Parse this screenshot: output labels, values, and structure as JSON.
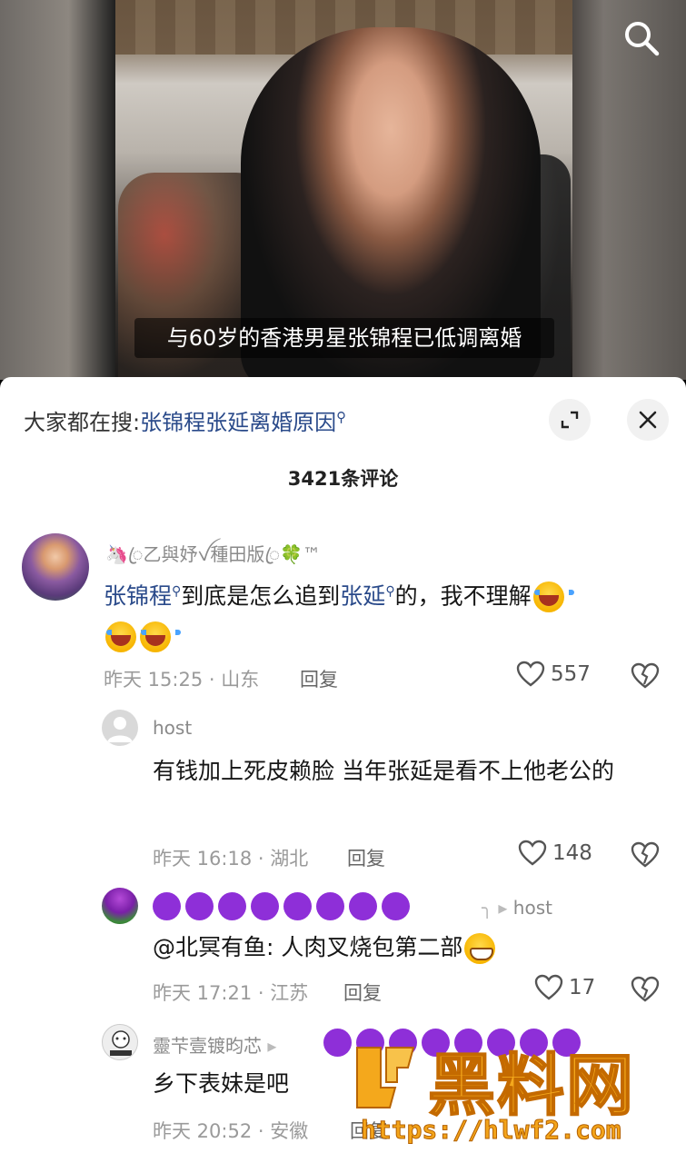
{
  "video": {
    "subtitle": "与60岁的香港男星张锦程已低调离婚"
  },
  "search_hint": {
    "prefix": "大家都在搜:",
    "keyword": "张锦程张延离婚原因"
  },
  "comment_count": "3421条评论",
  "comments": [
    {
      "username": "🦄ꦿ乙與妤ꪜ種田版ꦿ🍀™",
      "text_parts": {
        "link1": "张锦程",
        "mid1": "到底是怎么追到",
        "link2": "张延",
        "mid2": "的，我不理解"
      },
      "meta": "昨天 15:25 · 山东",
      "reply": "回复",
      "likes": "557"
    },
    {
      "username": "host",
      "text": "有钱加上死皮赖脸 当年张延是看不上他老公的",
      "meta": "昨天 16:18 · 湖北",
      "reply": "回复",
      "likes": "148"
    },
    {
      "reply_to": "host",
      "text": "@北冥有鱼: 人肉叉烧包第二部",
      "meta": "昨天 17:21 · 江苏",
      "reply": "回复",
      "likes": "17"
    },
    {
      "username": "靈芐壹镀昀芯",
      "text": "乡下表妹是吧",
      "meta": "昨天 20:52 · 安徽",
      "reply": "回复"
    }
  ],
  "watermark": {
    "brand": "黑料网",
    "url": "https://hlwf2.com"
  },
  "colors": {
    "link": "#2a4a8a",
    "purple_dot": "#8e2fd8",
    "watermark": "#f4a81c"
  }
}
